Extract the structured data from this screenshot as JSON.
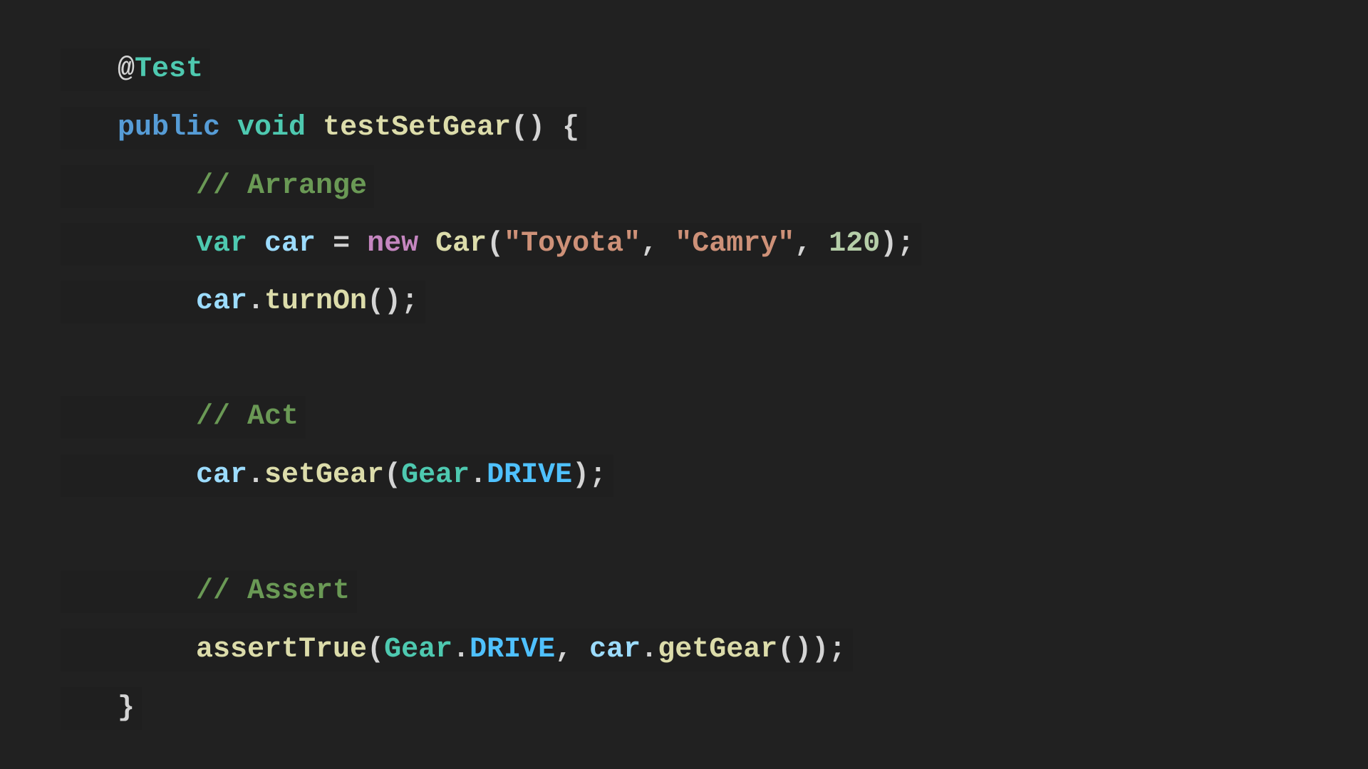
{
  "code": {
    "language": "java",
    "lines": [
      "@Test",
      "public void testSetGear() {",
      "    // Arrange",
      "    var car = new Car(\"Toyota\", \"Camry\", 120);",
      "    car.turnOn();",
      "",
      "    // Act",
      "    car.setGear(Gear.DRIVE);",
      "",
      "    // Assert",
      "    assertTrue(Gear.DRIVE, car.getGear());",
      "}"
    ]
  },
  "tokens": {
    "at": "@",
    "test": "Test",
    "public": "public",
    "void": "void",
    "method_name": "testSetGear",
    "parens": "()",
    "open_brace": "{",
    "comment_arrange": "// Arrange",
    "var": "var",
    "car": "car",
    "equals": "=",
    "new": "new",
    "car_class": "Car",
    "open_paren": "(",
    "str_toyota": "\"Toyota\"",
    "comma": ",",
    "str_camry": "\"Camry\"",
    "num_120": "120",
    "close_paren_semi": ");",
    "dot": ".",
    "turn_on": "turnOn",
    "parens_semi": "();",
    "comment_act": "// Act",
    "set_gear": "setGear",
    "gear": "Gear",
    "drive": "DRIVE",
    "comment_assert": "// Assert",
    "assert_true": "assertTrue",
    "get_gear": "getGear",
    "double_close_semi": "());",
    "close_brace": "}"
  },
  "colors": {
    "background": "#212121",
    "keyword": "#569cd6",
    "type": "#4ec9b0",
    "function": "#dcdcaa",
    "comment": "#6a9955",
    "variable": "#9cdcfe",
    "new_keyword": "#c586c0",
    "string": "#ce9178",
    "number": "#b5cea8",
    "constant": "#4fc1ff",
    "punctuation": "#d4d4d4"
  }
}
